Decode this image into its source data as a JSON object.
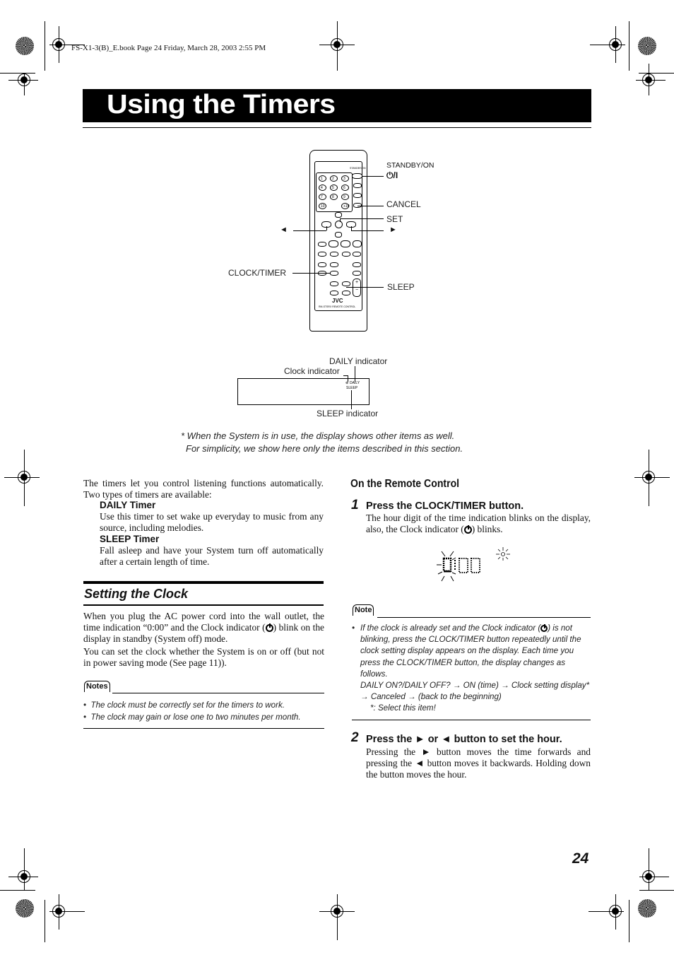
{
  "print_header": "FS-X1-3(B)_E.book  Page 24  Friday, March 28, 2003  2:55 PM",
  "title": "Using the Timers",
  "remote_diagram": {
    "labels": {
      "standby_on": "STANDBY/ON",
      "standby_symbol": "⏻/I",
      "cancel": "CANCEL",
      "set": "SET",
      "left_arrow": "◄",
      "right_arrow": "►",
      "clock_timer": "CLOCK/TIMER",
      "sleep": "SLEEP"
    },
    "remote_brand": "JVC",
    "remote_model": "RM-STSRX REMOTE CONTROL",
    "number_keys": [
      "1",
      "2",
      "3",
      "4",
      "5",
      "6",
      "7",
      "8",
      "9",
      "10",
      "",
      "+10"
    ]
  },
  "display_diagram": {
    "daily_indicator": "DAILY indicator",
    "clock_indicator": "Clock indicator",
    "sleep_indicator": "SLEEP indicator",
    "lcd_daily": "DAILY",
    "lcd_sleep": "SLEEP",
    "footnote_line1": "* When the System is in use, the display shows other items as well.",
    "footnote_line2": "For simplicity, we show here only the items described in this section."
  },
  "intro": {
    "paragraph": "The timers let you control listening functions automatically. Two types of timers are available:",
    "daily_heading": "DAILY Timer",
    "daily_text": "Use this timer to set wake up everyday to music from any source, including melodies.",
    "sleep_heading": "SLEEP Timer",
    "sleep_text": "Fall asleep and have your System turn off automatically after a certain length of time."
  },
  "setting_clock": {
    "heading": "Setting the Clock",
    "para1_a": "When you plug the AC power cord into the wall outlet, the time indication “0:00” and the Clock indicator (",
    "para1_b": ") blink on the display in standby (System off) mode.",
    "para2": "You can set the clock whether the System is on or off (but not in power saving mode (See page 11)).",
    "notes_label": "Notes",
    "notes": [
      "The clock must be correctly set for the timers to work.",
      "The clock may gain or lose one to two minutes per month."
    ]
  },
  "remote_section": {
    "heading": "On the Remote Control",
    "step1": {
      "number": "1",
      "title": "Press the CLOCK/TIMER button.",
      "text_a": "The hour digit of the time indication blinks on the display, also, the Clock indicator (",
      "text_b": ") blinks."
    },
    "lcd_time": "0:00",
    "note_label": "Note",
    "note_text_a": "If the clock is already set and the Clock indicator (",
    "note_text_b": ") is not blinking, press the CLOCK/TIMER button repeatedly until the clock setting display appears on the display. Each time you press the CLOCK/TIMER button, the display changes as follows.",
    "note_sequence": "DAILY ON?/DAILY OFF? → ON (time) → Clock setting display* → Canceled → (back to the beginning)",
    "note_footnote": "*: Select this item!",
    "step2": {
      "number": "2",
      "title": "Press the ► or ◄ button to set the hour.",
      "text": "Pressing the ► button moves the time forwards and pressing the ◄ button moves it backwards. Holding down the button moves the hour."
    }
  },
  "page_number": "24"
}
